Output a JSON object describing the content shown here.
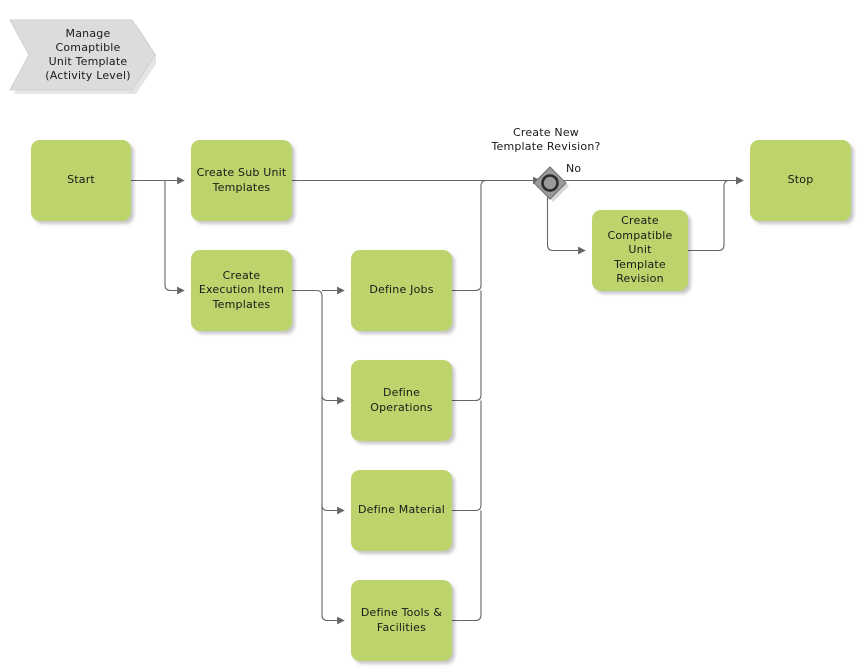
{
  "diagram": {
    "banner": {
      "line1": "Manage Comaptible",
      "line2": "Unit Template",
      "line3": "(Activity Level)",
      "fill": "#dcdcdc"
    },
    "colors": {
      "node_fill": "#bcd46b",
      "banner_fill": "#dcdcdc",
      "connector": "#666666",
      "gateway_fill": "#9a9a9a",
      "gateway_ring": "#333333",
      "text": "#1a1a1a"
    },
    "nodes": [
      {
        "id": "start",
        "label": "Start"
      },
      {
        "id": "create-sub-unit-templates",
        "line1": "Create Sub Unit",
        "line2": "Templates"
      },
      {
        "id": "create-execution-item-templates",
        "line1": "Create",
        "line2": "Execution Item",
        "line3": "Templates"
      },
      {
        "id": "define-jobs",
        "label": "Define Jobs"
      },
      {
        "id": "define-operations",
        "line1": "Define",
        "line2": "Operations"
      },
      {
        "id": "define-material",
        "label": "Define Material"
      },
      {
        "id": "define-tools-facilities",
        "line1": "Define Tools &",
        "line2": "Facilities"
      },
      {
        "id": "create-compatible-unit-template-revision",
        "line1": "Create",
        "line2": "Compatible Unit",
        "line3": "Template",
        "line4": "Revision"
      },
      {
        "id": "stop",
        "label": "Stop"
      }
    ],
    "gateway": {
      "id": "create-new-template-revision",
      "title_line1": "Create New",
      "title_line2": "Template Revision?",
      "branch_label_no": "No"
    }
  }
}
